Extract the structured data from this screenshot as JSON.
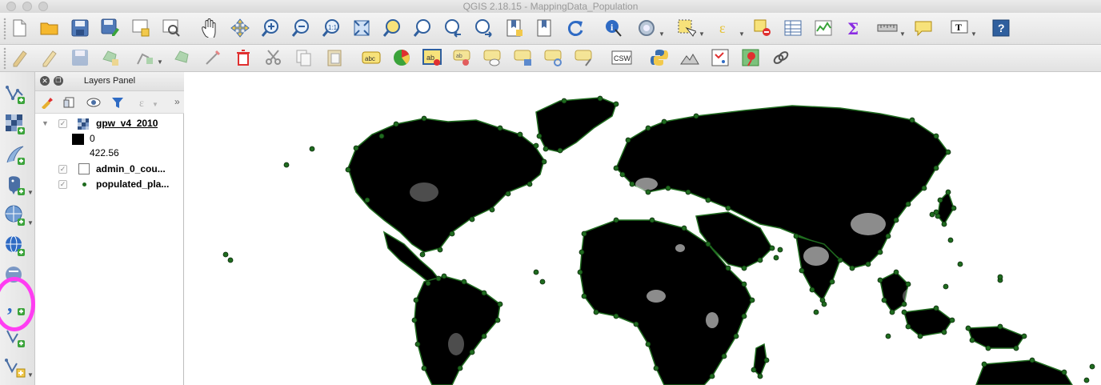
{
  "window": {
    "title": "QGIS 2.18.15 - MappingData_Population"
  },
  "toolbars": {
    "main_tools": [
      "new-project",
      "open-project",
      "save-project",
      "save-as",
      "new-print-composer",
      "composer-manager",
      "pan-map",
      "pan-to-selection",
      "zoom-in",
      "zoom-out",
      "zoom-native",
      "zoom-full",
      "zoom-to-selection",
      "zoom-to-layer",
      "zoom-last",
      "zoom-next",
      "new-bookmark",
      "show-bookmarks",
      "refresh",
      "identify",
      "run-action",
      "select-features",
      "select-by-expression",
      "deselect-all",
      "open-attribute-table",
      "open-field-calculator",
      "show-statistical-summary",
      "measure-line",
      "map-tips",
      "text-annotation",
      "help"
    ],
    "edit_tools": [
      "current-edits",
      "toggle-editing",
      "save-layer-edits",
      "add-feature",
      "node-tool",
      "move-feature",
      "modify-attributes",
      "delete-selected",
      "cut-features",
      "copy-features",
      "paste-features",
      "layer-labeling",
      "layer-styling",
      "highlight-pinned-labels",
      "pin-labels",
      "show-hide-labels",
      "move-label",
      "rotate-label",
      "change-label",
      "csw",
      "python-console",
      "terrain",
      "georeferencer",
      "place-pin",
      "link-tool"
    ]
  },
  "left_toolbar": {
    "items": [
      "add-vector-layer",
      "add-raster-layer",
      "add-spatialite-layer",
      "add-postgis-layer",
      "add-wms-layer",
      "add-wcs-layer",
      "add-wfs-layer",
      "add-delimited-text-layer",
      "add-virtual-layer",
      "new-shapefile-layer"
    ]
  },
  "layers_panel": {
    "title": "Layers Panel",
    "layers": [
      {
        "name": "gpw_v4_2010",
        "checked": true,
        "expanded": true,
        "type": "raster"
      },
      {
        "name": "admin_0_cou...",
        "checked": true,
        "type": "polygon"
      },
      {
        "name": "populated_pla...",
        "checked": true,
        "type": "point"
      }
    ],
    "legend": {
      "min": "0",
      "max": "422.56"
    }
  },
  "colors": {
    "highlight_ring": "#ff3df2",
    "point_fill": "#1f6b1f",
    "map_land": "#000000",
    "map_background": "#ffffff"
  }
}
